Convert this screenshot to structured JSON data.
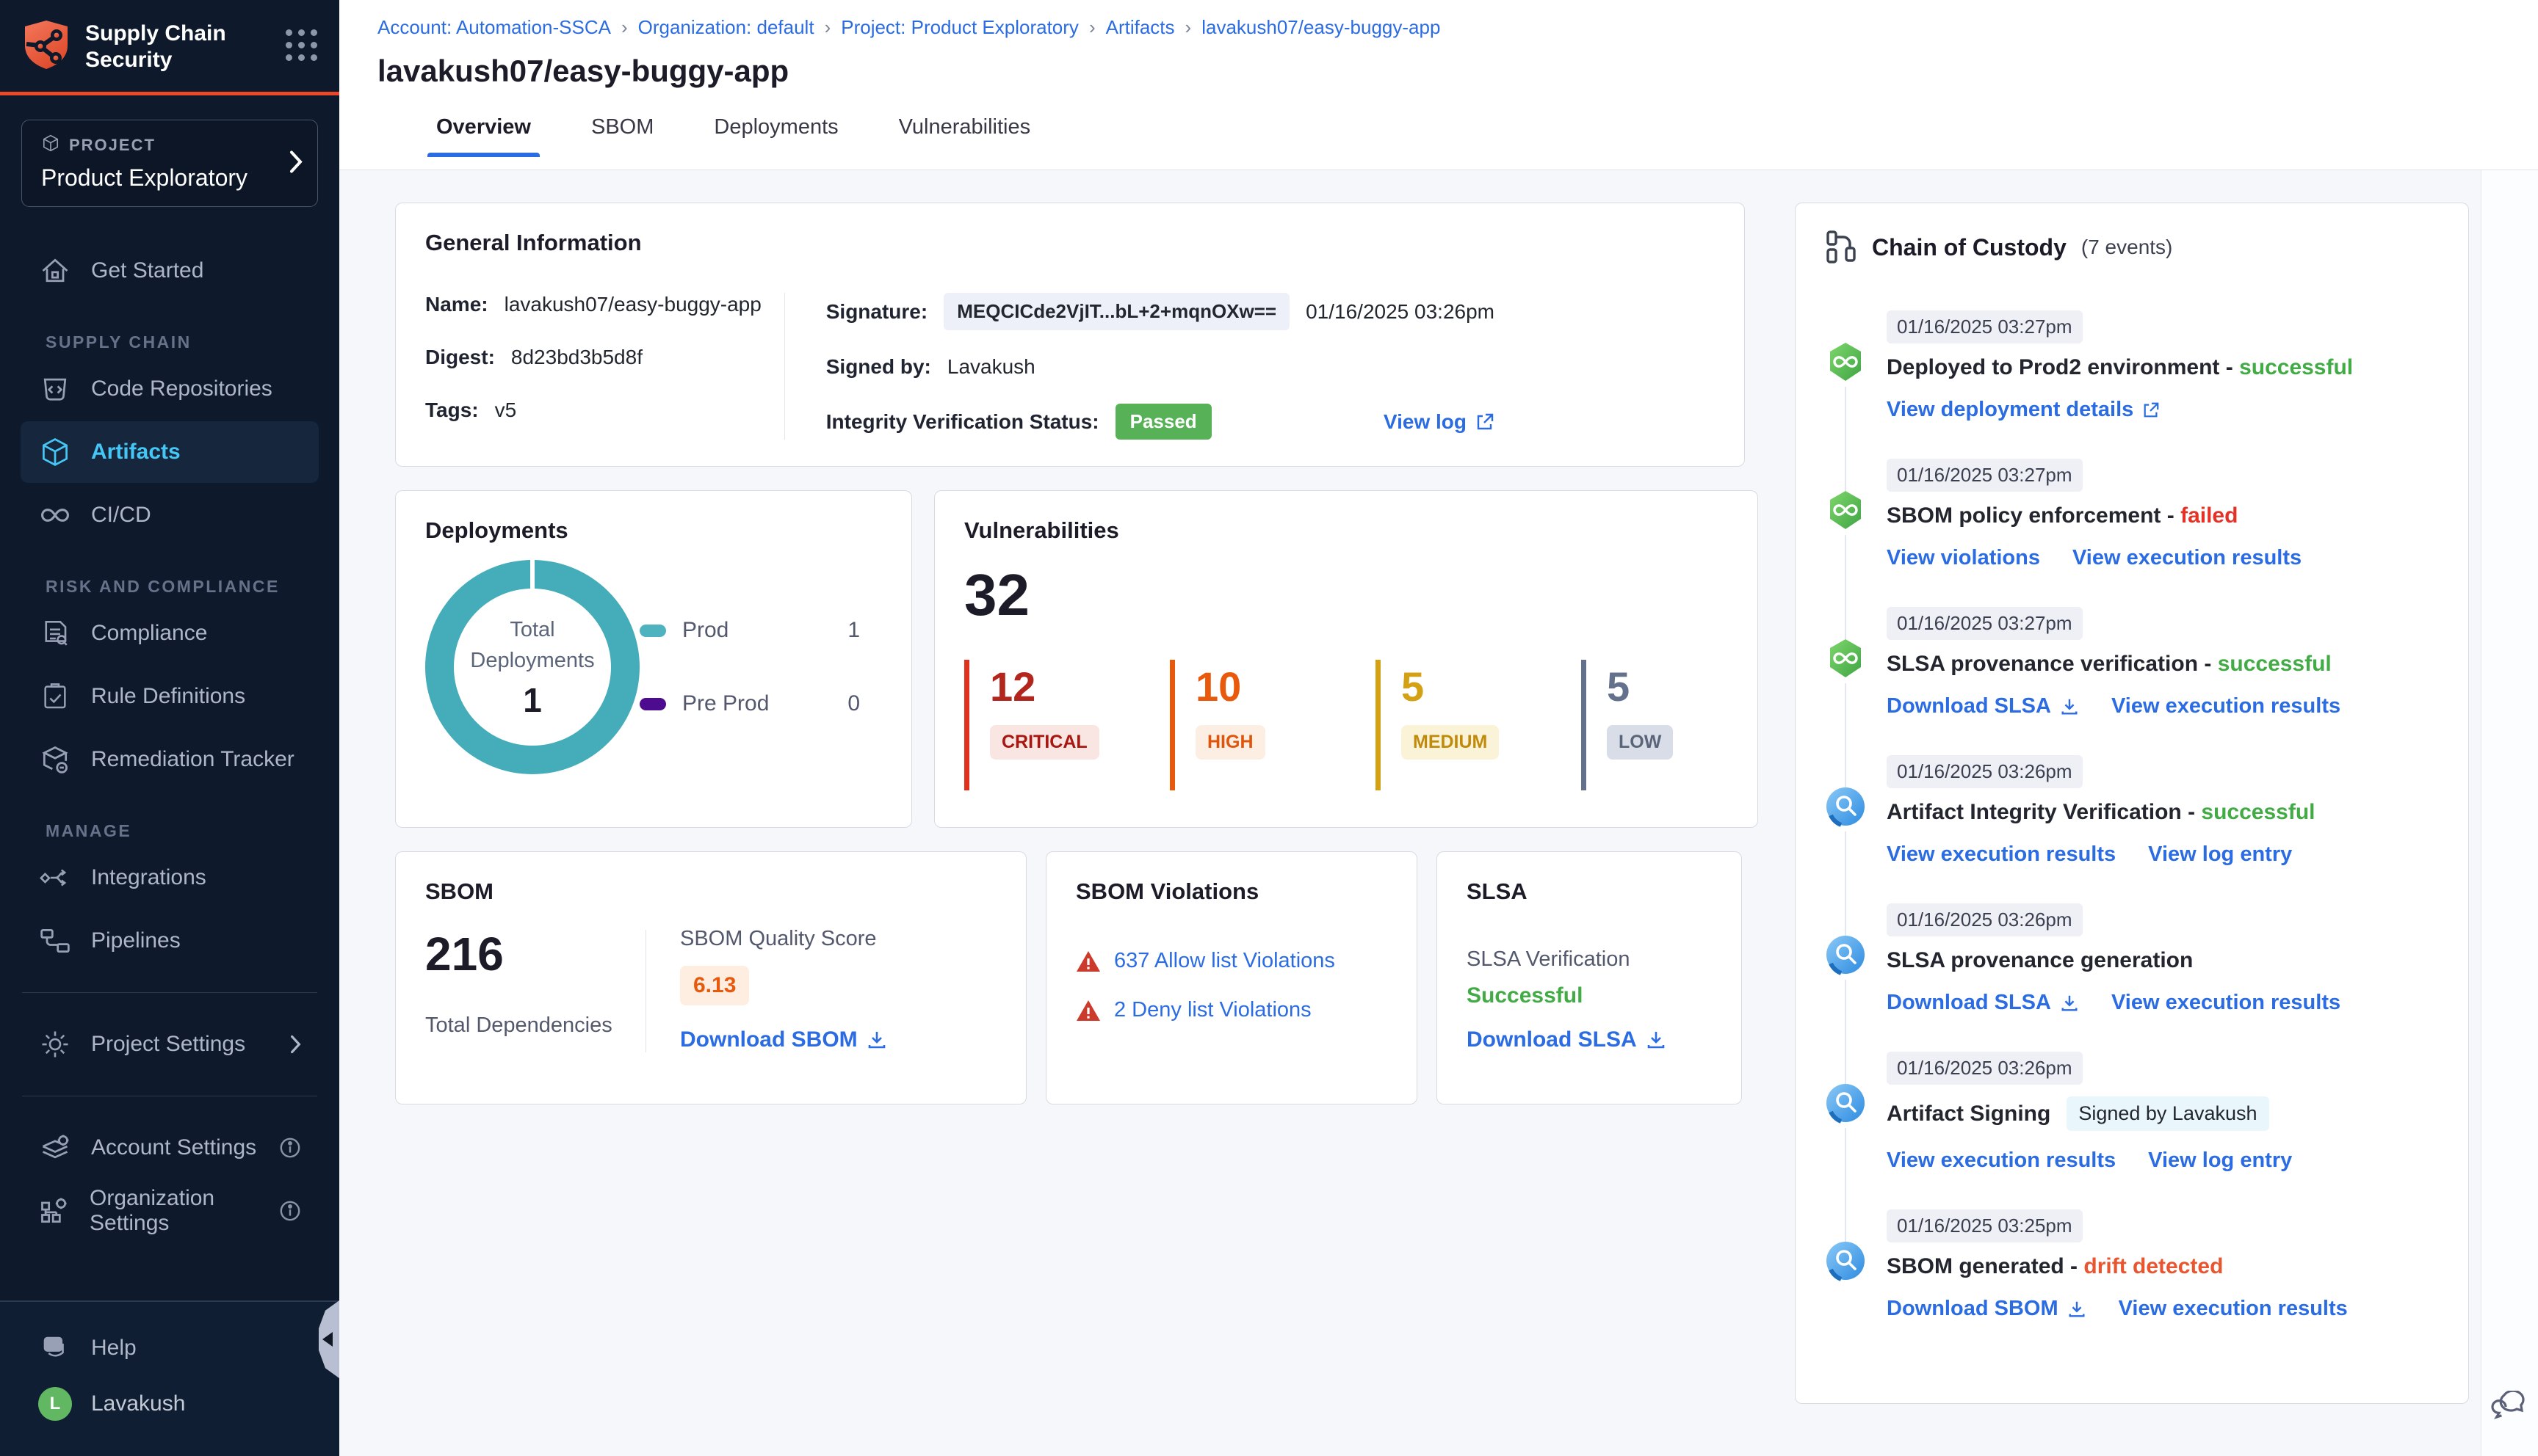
{
  "sidebar": {
    "logo_title_line1": "Supply Chain",
    "logo_title_line2": "Security",
    "project": {
      "kicker": "PROJECT",
      "name": "Product Exploratory"
    },
    "items": {
      "get_started": "Get Started",
      "code_repositories": "Code Repositories",
      "artifacts": "Artifacts",
      "cicd": "CI/CD",
      "compliance": "Compliance",
      "rule_definitions": "Rule Definitions",
      "remediation_tracker": "Remediation Tracker",
      "integrations": "Integrations",
      "pipelines": "Pipelines",
      "project_settings": "Project Settings",
      "account_settings": "Account Settings",
      "organization_settings": "Organization Settings",
      "help": "Help"
    },
    "sections": {
      "supply_chain": "SUPPLY CHAIN",
      "risk_and_compliance": "RISK AND COMPLIANCE",
      "manage": "MANAGE"
    },
    "user": {
      "name": "Lavakush",
      "initial": "L"
    }
  },
  "header": {
    "breadcrumb": [
      "Account: Automation-SSCA",
      "Organization: default",
      "Project: Product Exploratory",
      "Artifacts",
      "lavakush07/easy-buggy-app"
    ],
    "title": "lavakush07/easy-buggy-app",
    "tabs": [
      "Overview",
      "SBOM",
      "Deployments",
      "Vulnerabilities"
    ]
  },
  "general_info": {
    "title": "General Information",
    "name_label": "Name:",
    "name": "lavakush07/easy-buggy-app",
    "digest_label": "Digest:",
    "digest": "8d23bd3b5d8f",
    "tags_label": "Tags:",
    "tags": "v5",
    "signature_label": "Signature:",
    "signature": "MEQCICde2VjIT...bL+2+mqnOXw==",
    "signature_date": "01/16/2025 03:26pm",
    "signed_by_label": "Signed by:",
    "signed_by": "Lavakush",
    "integrity_label": "Integrity Verification Status:",
    "integrity_status": "Passed",
    "view_log": "View log"
  },
  "deployments": {
    "title": "Deployments",
    "center_label_1": "Total",
    "center_label_2": "Deployments",
    "total": "1",
    "donut_color": "#45ACBA",
    "legend": [
      {
        "label": "Prod",
        "count": "1",
        "color": "#4FB3BF"
      },
      {
        "label": "Pre Prod",
        "count": "0",
        "color": "#4D0B8F"
      }
    ]
  },
  "vulnerabilities": {
    "title": "Vulnerabilities",
    "total": "32",
    "severities": [
      {
        "count": "12",
        "label": "CRITICAL",
        "color": "#B3261E"
      },
      {
        "count": "10",
        "label": "HIGH",
        "color": "#E8590C"
      },
      {
        "count": "5",
        "label": "MEDIUM",
        "color": "#D4A114"
      },
      {
        "count": "5",
        "label": "LOW",
        "color": "#64718C"
      }
    ]
  },
  "sbom": {
    "title": "SBOM",
    "total": "216",
    "total_label": "Total Dependencies",
    "quality_label": "SBOM Quality Score",
    "quality_score": "6.13",
    "download": "Download SBOM"
  },
  "sbom_violations": {
    "title": "SBOM Violations",
    "allow": "637 Allow list Violations",
    "deny": "2 Deny list Violations"
  },
  "slsa": {
    "title": "SLSA",
    "verification_label": "SLSA Verification",
    "status": "Successful",
    "download": "Download SLSA"
  },
  "chain_of_custody": {
    "title": "Chain of Custody",
    "events_count": "(7 events)",
    "events": [
      {
        "timestamp": "01/16/2025 03:27pm",
        "icon": "cd",
        "title": "Deployed to Prod2 environment",
        "sep": " - ",
        "status": "successful",
        "status_color": "#42AB45",
        "links": [
          {
            "label": "View deployment details",
            "icon": "external"
          }
        ]
      },
      {
        "timestamp": "01/16/2025 03:27pm",
        "icon": "cd",
        "title": "SBOM policy enforcement",
        "sep": " - ",
        "status": "failed",
        "status_color": "#E43326",
        "links": [
          {
            "label": "View violations"
          },
          {
            "label": "View execution results"
          }
        ]
      },
      {
        "timestamp": "01/16/2025 03:27pm",
        "icon": "cd",
        "title": "SLSA provenance verification",
        "sep": " - ",
        "status": "successful",
        "status_color": "#42AB45",
        "links": [
          {
            "label": "Download SLSA",
            "icon": "download"
          },
          {
            "label": "View execution results"
          }
        ]
      },
      {
        "timestamp": "01/16/2025 03:26pm",
        "icon": "scs",
        "title": "Artifact Integrity Verification",
        "sep": " - ",
        "status": "successful",
        "status_color": "#42AB45",
        "links": [
          {
            "label": "View execution results"
          },
          {
            "label": "View log entry"
          }
        ]
      },
      {
        "timestamp": "01/16/2025 03:26pm",
        "icon": "scs",
        "title": "SLSA provenance generation",
        "links": [
          {
            "label": "Download SLSA",
            "icon": "download"
          },
          {
            "label": "View execution results"
          }
        ]
      },
      {
        "timestamp": "01/16/2025 03:26pm",
        "icon": "scs",
        "title": "Artifact Signing",
        "badge": "Signed by Lavakush",
        "links": [
          {
            "label": "View execution results"
          },
          {
            "label": "View log entry"
          }
        ]
      },
      {
        "timestamp": "01/16/2025 03:25pm",
        "icon": "scs",
        "title": "SBOM generated",
        "sep": " - ",
        "status": "drift detected",
        "status_color": "#E8552E",
        "links": [
          {
            "label": "Download SBOM",
            "icon": "download"
          },
          {
            "label": "View execution results"
          }
        ]
      }
    ]
  }
}
